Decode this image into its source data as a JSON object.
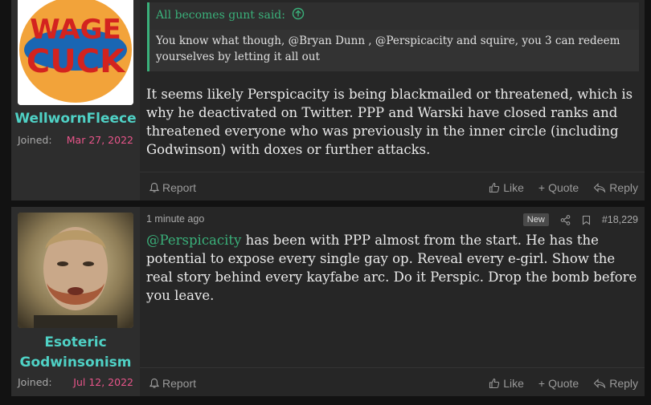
{
  "posts": [
    {
      "username": "WellwornFleece",
      "joined_label": "Joined:",
      "joined_date": "Mar 27, 2022",
      "avatar_text": [
        "WAGE",
        "CUCK"
      ],
      "quote": {
        "author_line": "All becomes gunt said:",
        "body": "You know what though, @Bryan Dunn , @Perspicacity and squire, you 3 can redeem yourselves by letting it all out"
      },
      "message": "It seems likely Perspicacity is being blackmailed or threatened, which is why he deactivated on Twitter. PPP and Warski have closed ranks and threatened everyone who was previously in the inner circle (including Godwinson) with doxes or further attacks.",
      "report_label": "Report",
      "like_label": "Like",
      "quote_label": "Quote",
      "reply_label": "Reply"
    },
    {
      "username": "Esoteric Godwinsonism",
      "joined_label": "Joined:",
      "joined_date": "Jul 12, 2022",
      "time": "1 minute ago",
      "badge": "New",
      "post_number": "#18,229",
      "mention": "@Perspicacity",
      "message": " has been with PPP almost from the start. He has the potential to expose every single gay op. Reveal every e-girl. Show the real story behind every kayfabe arc. Do it Perspic. Drop the bomb before you leave.",
      "report_label": "Report",
      "like_label": "Like",
      "quote_label": "Quote",
      "reply_label": "Reply"
    }
  ],
  "colors": {
    "accent": "#3ab07a",
    "username": "#4fd1c5",
    "joined_date": "#e8558a"
  }
}
